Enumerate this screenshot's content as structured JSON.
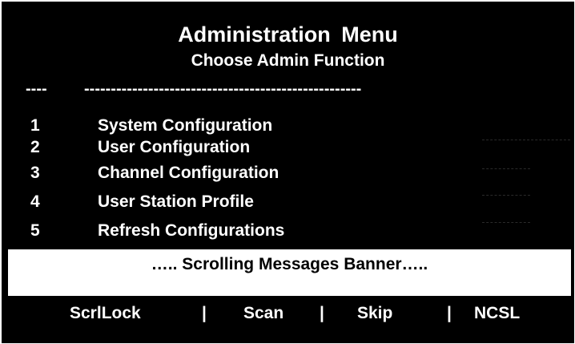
{
  "header": {
    "title": "Administration  Menu",
    "subtitle": "Choose Admin Function"
  },
  "divider": {
    "short": "----",
    "long": "----------------------------------------------------"
  },
  "menu": {
    "items": [
      {
        "number": "1",
        "label": "System Configuration"
      },
      {
        "number": "2",
        "label": "User Configuration"
      },
      {
        "number": "3",
        "label": "Channel Configuration"
      },
      {
        "number": "4",
        "label": "User Station Profile"
      },
      {
        "number": "5",
        "label": "Refresh Configurations"
      }
    ]
  },
  "banner": {
    "text": "….. Scrolling Messages Banner….."
  },
  "softkeys": {
    "separator": "|",
    "items": [
      {
        "label": "ScrlLock"
      },
      {
        "label": "Scan"
      },
      {
        "label": "Skip"
      },
      {
        "label": "NCSL"
      }
    ]
  },
  "colors": {
    "background": "#000000",
    "text": "#ffffff",
    "banner_background": "#ffffff",
    "banner_text": "#000000"
  }
}
